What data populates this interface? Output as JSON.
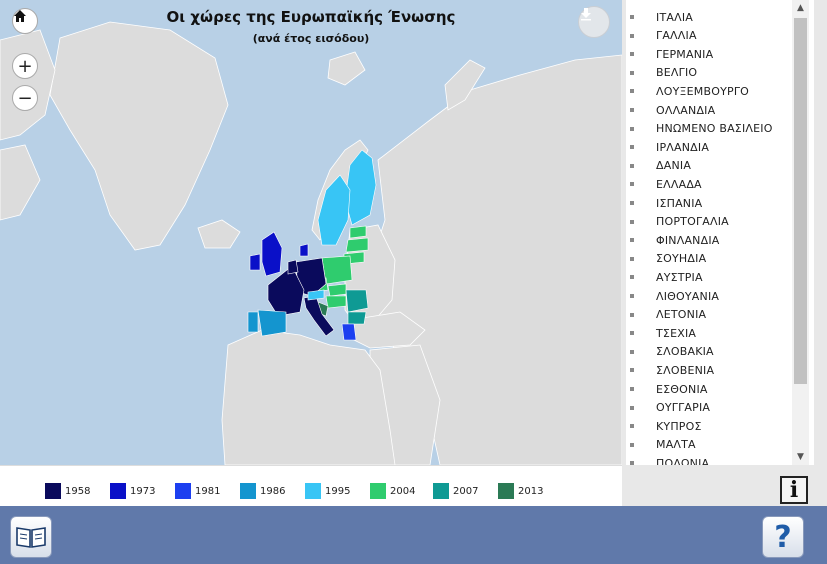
{
  "map": {
    "title": "Οι χώρες της Ευρωπαϊκής Ένωσης",
    "subtitle": "(ανά έτος εισόδου)",
    "zoom_in_label": "+",
    "zoom_out_label": "−",
    "home_icon": "home-icon",
    "download_icon": "download-icon"
  },
  "colors": {
    "sea": "#b8d0e6",
    "land": "#dcdcdc",
    "1958": "#0a0a5c",
    "1973": "#0a10c8",
    "1981": "#1c3ff0",
    "1986": "#1495cf",
    "1995": "#38c5f5",
    "2004": "#2fcc6e",
    "2007": "#0f9a94",
    "2013": "#2b7a55"
  },
  "legend": [
    {
      "year": "1958",
      "color": "#0a0a5c"
    },
    {
      "year": "1973",
      "color": "#0a10c8"
    },
    {
      "year": "1981",
      "color": "#1c3ff0"
    },
    {
      "year": "1986",
      "color": "#1495cf"
    },
    {
      "year": "1995",
      "color": "#38c5f5"
    },
    {
      "year": "2004",
      "color": "#2fcc6e"
    },
    {
      "year": "2007",
      "color": "#0f9a94"
    },
    {
      "year": "2013",
      "color": "#2b7a55"
    }
  ],
  "countries": [
    "ΙΤΑΛΙΑ",
    "ΓΑΛΛΙΑ",
    "ΓΕΡΜΑΝΙΑ",
    "ΒΕΛΓΙΟ",
    "ΛΟΥΞΕΜΒΟΥΡΓΟ",
    "ΟΛΛΑΝΔΙΑ",
    "ΗΝΩΜΕΝΟ ΒΑΣΙΛΕΙΟ",
    "ΙΡΛΑΝΔΙΑ",
    "ΔΑΝΙΑ",
    "ΕΛΛΑΔΑ",
    "ΙΣΠΑΝΙΑ",
    "ΠΟΡΤΟΓΑΛΙΑ",
    "ΦΙΝΛΑΝΔΙΑ",
    "ΣΟΥΗΔΙΑ",
    "ΑΥΣΤΡΙΑ",
    "ΛΙΘΟΥΑΝΙΑ",
    "ΛΕΤΟΝΙΑ",
    "ΤΣΕΧΙΑ",
    "ΣΛΟΒΑΚΙΑ",
    "ΣΛΟΒΕΝΙΑ",
    "ΕΣΘΟΝΙΑ",
    "ΟΥΓΓΑΡΙΑ",
    "ΚΥΠΡΟΣ",
    "ΜΑΛΤΑ",
    "ΠΟΛΩΝΙΑ"
  ],
  "controls": {
    "info_label": "i",
    "help_label": "?",
    "scroll_up": "▲",
    "scroll_down": "▼"
  }
}
